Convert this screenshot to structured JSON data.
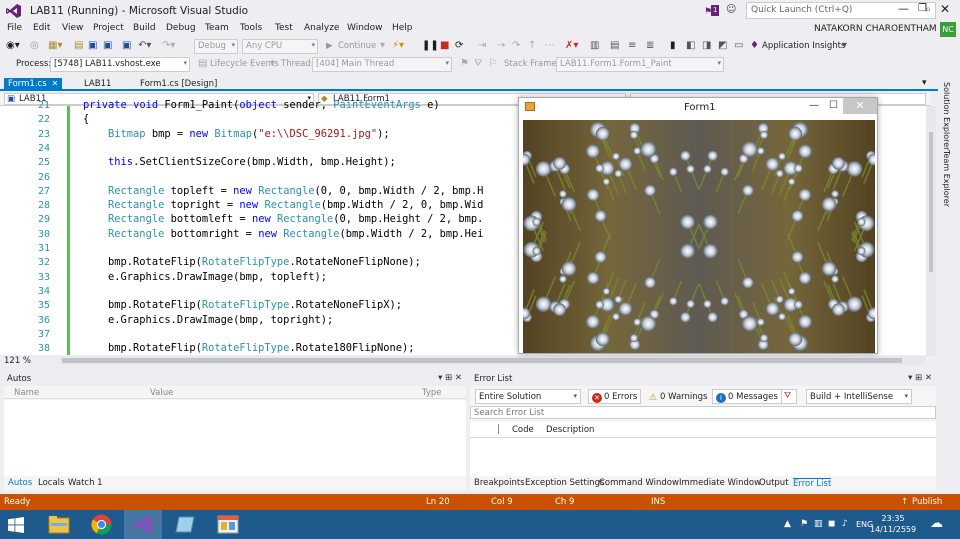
{
  "window": {
    "title": "LAB11 (Running) - Microsoft Visual Studio",
    "notification_count": "1",
    "quick_launch_placeholder": "Quick Launch (Ctrl+Q)"
  },
  "menu": {
    "items": [
      "File",
      "Edit",
      "View",
      "Project",
      "Build",
      "Debug",
      "Team",
      "Tools",
      "Test",
      "Analyze",
      "Window",
      "Help"
    ],
    "user_name": "NATAKORN CHAROENTHAM",
    "user_initials": "NC"
  },
  "toolbar": {
    "config": "Debug",
    "platform": "Any CPU",
    "continue_label": "Continue",
    "app_insights": "Application Insights"
  },
  "debug_bar": {
    "process_label": "Process:",
    "process_value": "[5748] LAB11.vshost.exe",
    "lifecycle_label": "Lifecycle Events",
    "thread_label": "Thread:",
    "thread_value": "[404] Main Thread",
    "stack_label": "Stack Frame:",
    "stack_value": "LAB11.Form1.Form1_Paint"
  },
  "tabs": [
    {
      "label": "Form1.cs",
      "active": true
    },
    {
      "label": "LAB11",
      "active": false
    },
    {
      "label": "Form1.cs [Design]",
      "active": false
    }
  ],
  "editor": {
    "nav_project": "LAB11",
    "nav_class": "LAB11.Form1",
    "zoom": "121 %",
    "line_numbers": [
      "21",
      "22",
      "23",
      "24",
      "25",
      "26",
      "27",
      "28",
      "29",
      "30",
      "31",
      "32",
      "33",
      "34",
      "35",
      "36",
      "37",
      "38"
    ],
    "code_lines": [
      "private void Form1_Paint(object sender, PaintEventArgs e)",
      "{",
      "    Bitmap bmp = new Bitmap(\"e:\\\\DSC_96291.jpg\");",
      "",
      "    this.SetClientSizeCore(bmp.Width, bmp.Height);",
      "",
      "    Rectangle topleft = new Rectangle(0, 0, bmp.Width / 2, bmp.H",
      "    Rectangle topright = new Rectangle(bmp.Width / 2, 0, bmp.Wid",
      "    Rectangle bottomleft = new Rectangle(0, bmp.Height / 2, bmp.",
      "    Rectangle bottomright = new Rectangle(bmp.Width / 2, bmp.Hei",
      "",
      "    bmp.RotateFlip(RotateFlipType.RotateNoneFlipNone);",
      "    e.Graphics.DrawImage(bmp, topleft);",
      "",
      "    bmp.RotateFlip(RotateFlipType.RotateNoneFlipX);",
      "    e.Graphics.DrawImage(bmp, topright);",
      "",
      "    bmp.RotateFlip(RotateFlipType.Rotate180FlipNone);"
    ]
  },
  "form1": {
    "title": "Form1"
  },
  "side_tabs": [
    "Solution Explorer",
    "Team Explorer"
  ],
  "autos": {
    "title": "Autos",
    "col_name": "Name",
    "col_value": "Value",
    "col_type": "Type",
    "tabs": [
      "Autos",
      "Locals",
      "Watch 1"
    ]
  },
  "error_list": {
    "title": "Error List",
    "scope": "Entire Solution",
    "errors": "0 Errors",
    "warnings": "0 Warnings",
    "messages": "0 Messages",
    "build_filter": "Build + IntelliSense",
    "search_placeholder": "Search Error List",
    "col_code": "Code",
    "col_description": "Description",
    "tabs": [
      "Breakpoints",
      "Exception Settings",
      "Command Window",
      "Immediate Window",
      "Output",
      "Error List"
    ]
  },
  "status": {
    "state": "Ready",
    "line": "Ln 20",
    "col": "Col 9",
    "ch": "Ch 9",
    "mode": "INS",
    "publish": "Publish"
  },
  "taskbar": {
    "lang": "ENG",
    "time": "23:35",
    "date": "14/11/2559"
  },
  "colors": {
    "accent": "#007acc",
    "status_bar": "#ca5100",
    "taskbar": "#1f5a8c"
  }
}
